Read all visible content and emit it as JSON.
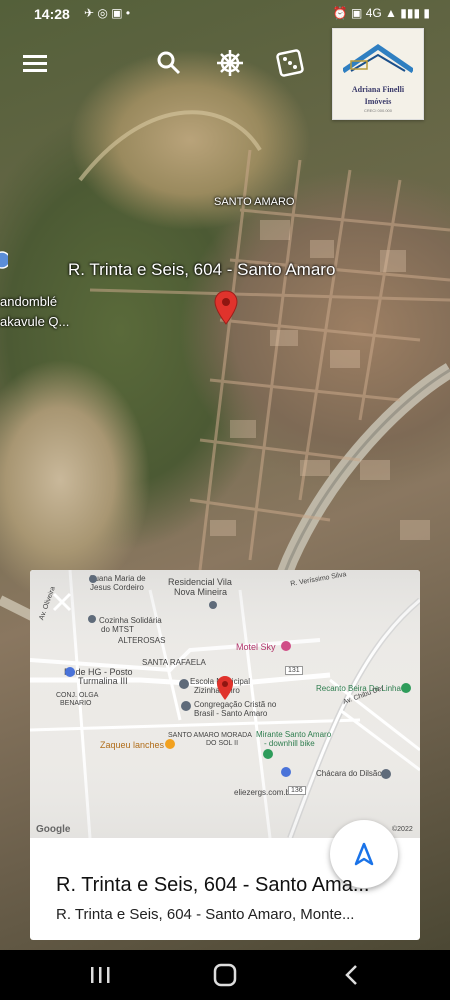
{
  "status_bar": {
    "time": "14:28",
    "left_icons": "✈ ◎ ▣ •",
    "right_icons": "⏰ ▣ 4G ▲ ▮▮▮ ▮"
  },
  "toolbar": {
    "menu_icon": "menu-icon",
    "search_icon": "search-icon",
    "steering_icon": "ship-wheel-icon",
    "dice_icon": "dice-icon"
  },
  "logo": {
    "name": "Adriana Finelli",
    "sub": "Imóveis",
    "tiny": "CRECI 000.000"
  },
  "map": {
    "neighborhood_label": "SANTO AMARO",
    "address_label": "R. Trinta e Seis, 604 - Santo Amaro",
    "poi_left_1": "andomblé",
    "poi_left_2": "akavule Q..."
  },
  "card": {
    "close_icon": "close-icon",
    "minimap_labels": {
      "luana": "Luana Maria de",
      "luana2": "Jesus Cordeiro",
      "residencial": "Residencial Vila",
      "residencial2": "Nova Mineira",
      "cozinha": "Cozinha Solidária",
      "cozinha2": "do MTST",
      "alterosas": "ALTEROSAS",
      "santa_rafaela": "SANTA RAFAELA",
      "motel": "Motel Sky",
      "rede": "Rede HG - Posto",
      "rede2": "Turmalina III",
      "conj1": "CONJ. OLGA",
      "conj2": "BENARIO",
      "escola": "Escola Municipal",
      "escola2": "Zizinha Leiro",
      "congregacao": "Congregação Cristã no",
      "congregacao2": "Brasil - Santo Amaro",
      "recanto": "Recanto Beira Da Linha",
      "zaqueu": "Zaqueu lanches",
      "santo_amaro_morada": "SANTO AMARO MORADA",
      "sol": "DO SOL II",
      "mirante": "Mirante Santo Amaro",
      "downhill": "- downhill bike",
      "chacara": "Chácara do Dilsão",
      "eliezer": "eliezergs.com.br",
      "google": "Google",
      "copyright": "©2022",
      "road_131": "131",
      "road_136": "136",
      "verissimo": "R. Veríssimo Silva",
      "oliveira": "Av. Oliveira",
      "chibu": "Av. Chibu Der"
    },
    "title": "R. Trinta e Seis, 604 - Santo Ama...",
    "subtitle": "R. Trinta e Seis, 604 - Santo Amaro, Monte..."
  },
  "nav_bar": {
    "recents_icon": "recents-icon",
    "home_icon": "home-icon",
    "back_icon": "back-icon"
  }
}
